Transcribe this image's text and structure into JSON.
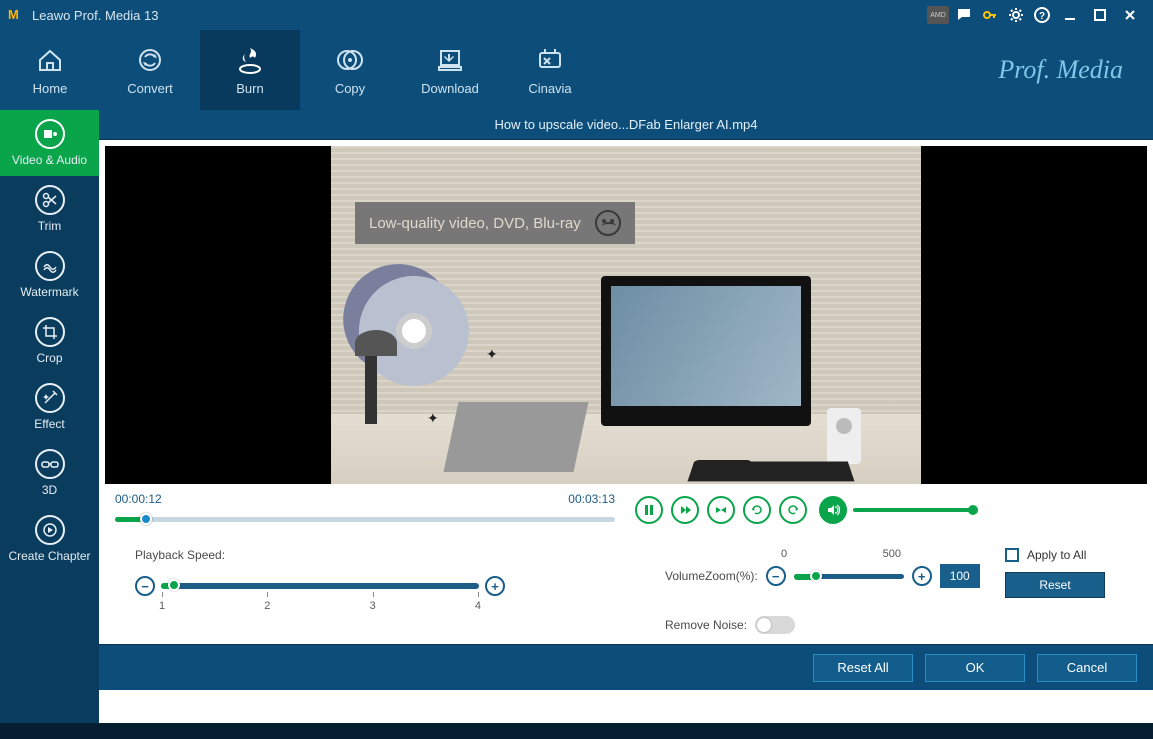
{
  "app": {
    "title": "Leawo Prof. Media 13",
    "brand": "Prof. Media"
  },
  "titlebar_icons": {
    "amd": "AMD",
    "chat": "chat",
    "key": "key",
    "gear": "settings",
    "help": "help"
  },
  "nav": {
    "home": "Home",
    "convert": "Convert",
    "burn": "Burn",
    "copy": "Copy",
    "download": "Download",
    "cinavia": "Cinavia",
    "active": "burn"
  },
  "sidebar": {
    "video_audio": "Video & Audio",
    "trim": "Trim",
    "watermark": "Watermark",
    "crop": "Crop",
    "effect": "Effect",
    "three_d": "3D",
    "create_chapter": "Create Chapter",
    "active": "video_audio"
  },
  "file": {
    "title": "How to upscale video...DFab Enlarger AI.mp4"
  },
  "overlay": {
    "caption": "Low-quality video, DVD, Blu-ray"
  },
  "player": {
    "current": "00:00:12",
    "total": "00:03:13",
    "progress_pct": 6.2,
    "volume_pct": 100
  },
  "playback": {
    "label": "Playback Speed:",
    "ticks": [
      "1",
      "2",
      "3",
      "4"
    ],
    "value": 1
  },
  "volumezoom": {
    "label": "VolumeZoom(%):",
    "min": "0",
    "max": "500",
    "value": "100"
  },
  "removenoise": {
    "label": "Remove Noise:",
    "on": false
  },
  "apply_all": {
    "label": "Apply to All",
    "checked": false
  },
  "buttons": {
    "reset": "Reset",
    "reset_all": "Reset All",
    "ok": "OK",
    "cancel": "Cancel"
  }
}
